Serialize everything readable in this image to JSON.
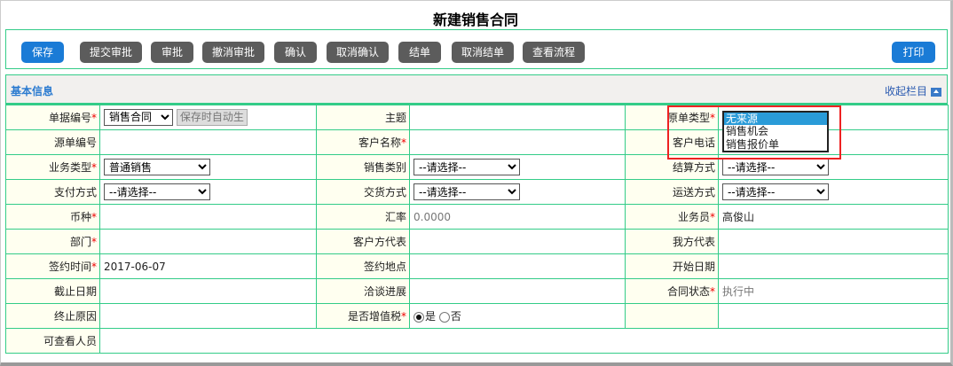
{
  "title": "新建销售合同",
  "toolbar": {
    "buttons": [
      "保存",
      "提交审批",
      "审批",
      "撤消审批",
      "确认",
      "取消确认",
      "结单",
      "取消结单",
      "查看流程"
    ],
    "print": "打印"
  },
  "section": {
    "title": "基本信息",
    "collapse": "收起栏目",
    "collapse_icon": "collapse-up-icon"
  },
  "fields": {
    "doc_no": {
      "label": "单据编号",
      "select": "销售合同",
      "auto": "保存时自动生"
    },
    "subject": {
      "label": "主题"
    },
    "source_type": {
      "label": "原单类型",
      "options": [
        "无来源",
        "销售机会",
        "销售报价单"
      ],
      "selected": "无来源"
    },
    "source_no": {
      "label": "源单编号"
    },
    "customer": {
      "label": "客户名称"
    },
    "phone": {
      "label": "客户电话"
    },
    "biz_type": {
      "label": "业务类型",
      "value": "普通销售"
    },
    "sale_cat": {
      "label": "销售类别",
      "value": "--请选择--"
    },
    "settle": {
      "label": "结算方式",
      "value": "--请选择--"
    },
    "pay": {
      "label": "支付方式",
      "value": "--请选择--"
    },
    "delivery": {
      "label": "交货方式",
      "value": "--请选择--"
    },
    "ship": {
      "label": "运送方式",
      "value": "--请选择--"
    },
    "currency": {
      "label": "币种"
    },
    "rate": {
      "label": "汇率",
      "value": "0.0000"
    },
    "sales": {
      "label": "业务员",
      "value": "高俊山"
    },
    "dept": {
      "label": "部门"
    },
    "cust_rep": {
      "label": "客户方代表"
    },
    "our_rep": {
      "label": "我方代表"
    },
    "sign_date": {
      "label": "签约时间",
      "value": "2017-06-07"
    },
    "sign_place": {
      "label": "签约地点"
    },
    "start": {
      "label": "开始日期"
    },
    "end": {
      "label": "截止日期"
    },
    "progress": {
      "label": "洽谈进展"
    },
    "status": {
      "label": "合同状态",
      "value": "执行中"
    },
    "term_reason": {
      "label": "终止原因"
    },
    "vat": {
      "label": "是否增值税",
      "yes": "是",
      "no": "否",
      "selected": "是"
    },
    "viewers": {
      "label": "可查看人员"
    }
  },
  "required_mark": "*",
  "colors": {
    "primary": "#1a7bd6",
    "button": "#5c5c5c",
    "border": "#33cc88",
    "highlight": "#ee2222"
  }
}
